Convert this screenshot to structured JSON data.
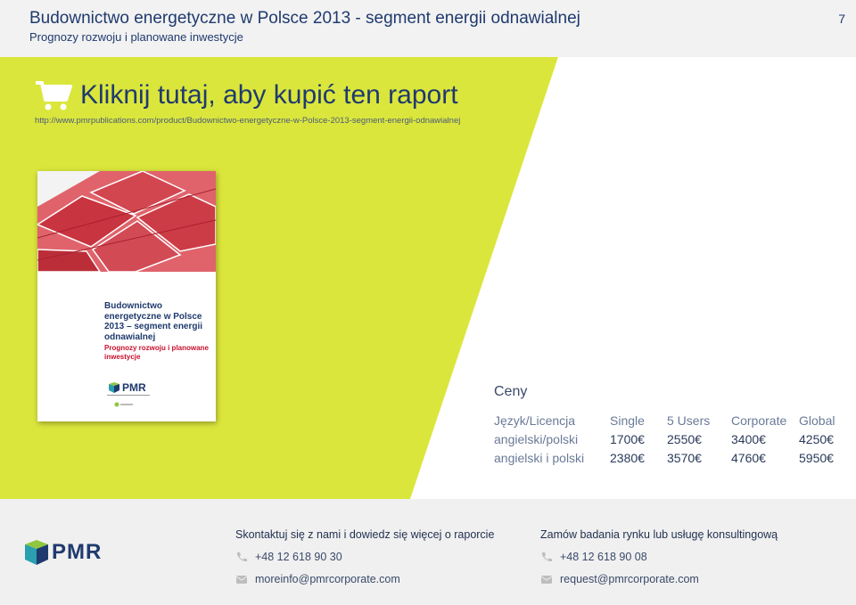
{
  "header": {
    "title": "Budownictwo energetyczne w Polsce 2013 - segment energii odnawialnej",
    "subtitle": "Prognozy rozwoju i planowane inwestycje",
    "page_number": "7"
  },
  "buy": {
    "label": "Kliknij tutaj, aby kupić ten raport",
    "url": "http://www.pmrpublications.com/product/Budownictwo-energetyczne-w-Polsce-2013-segment-energii-odnawialnej"
  },
  "cover": {
    "title_lines": "Budownictwo energetyczne w Polsce 2013 – segment energii odnawialnej",
    "subtitle_lines": "Prognozy rozwoju i planowane inwestycje",
    "logo": "PMR"
  },
  "prices": {
    "title": "Ceny",
    "headers": [
      "Język/Licencja",
      "Single",
      "5 Users",
      "Corporate",
      "Global"
    ],
    "rows": [
      [
        "angielski/polski",
        "1700€",
        "2550€",
        "3400€",
        "4250€"
      ],
      [
        "angielski i polski",
        "2380€",
        "3570€",
        "4760€",
        "5950€"
      ]
    ]
  },
  "footer": {
    "logo": "PMR",
    "contact_left": {
      "title": "Skontaktuj się z nami i dowiedz się więcej o raporcie",
      "phone": "+48 12 618 90 30",
      "email": "moreinfo@pmrcorporate.com"
    },
    "contact_right": {
      "title": "Zamów badania rynku lub usługę konsultingową",
      "phone": "+48 12 618 90 08",
      "email": "request@pmrcorporate.com"
    }
  },
  "colors": {
    "accent_green": "#dbe63c",
    "brand_navy": "#1f3a6e",
    "panel_gray": "#f2f2f2"
  }
}
